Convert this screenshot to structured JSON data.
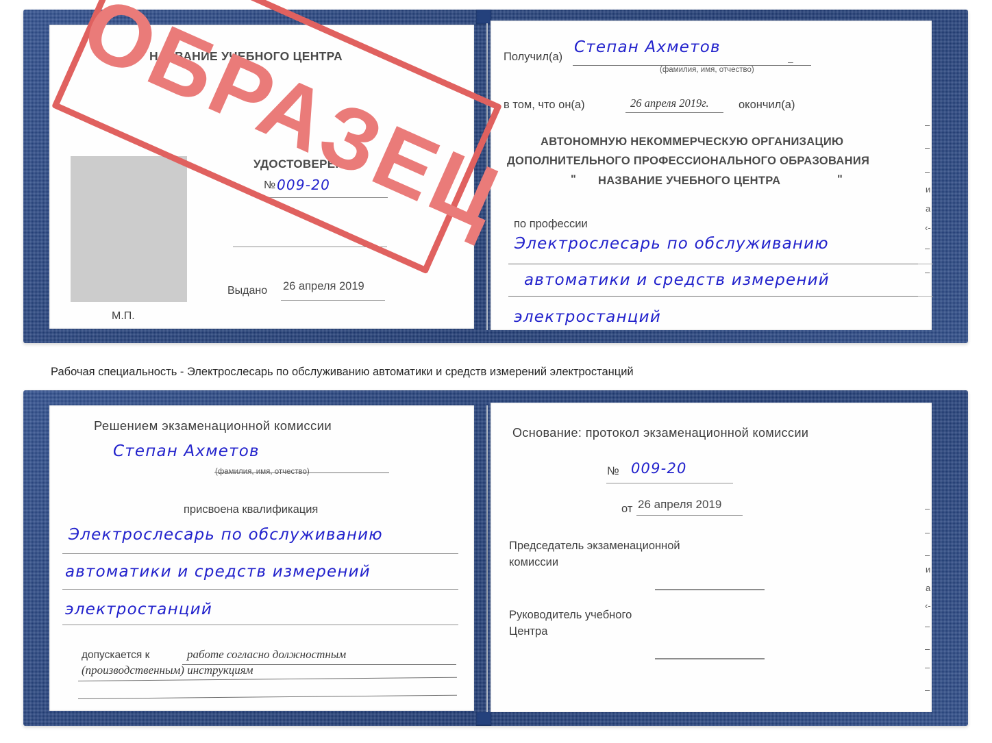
{
  "caption": "Рабочая специальность - Электрослесарь по обслуживанию автоматики и средств измерений электростанций",
  "stamp": {
    "text": "ОБРАЗЕЦ",
    "border_color": "#e0615f",
    "text_color": "#ea7b79"
  },
  "colors": {
    "cover_blue": "#24417c",
    "ink_blue": "#2222cc",
    "paper": "#fefefe",
    "photo_placeholder": "#cccccc",
    "rule_grey": "#8d8d8d"
  },
  "certificate_top": {
    "left_page": {
      "center_name": "НАЗВАНИЕ УЧЕБНОГО ЦЕНТРА",
      "doc_type": "УДОСТОВЕРЕНИЕ",
      "number_label": "№",
      "number_value": "009-20",
      "issued_label": "Выдано",
      "issued_date": "26 апреля 2019",
      "seal_label": "М.П."
    },
    "right_page": {
      "received_label": "Получил(а)",
      "received_name": "Степан Ахметов",
      "name_hint": "(фамилия, имя, отчество)",
      "in_that_label": "в том, что он(а)",
      "completion_date": "26 апреля 2019г.",
      "finished_label": "окончил(а)",
      "org_line1": "АВТОНОМНУЮ НЕКОММЕРЧЕСКУЮ ОРГАНИЗАЦИЮ",
      "org_line2": "ДОПОЛНИТЕЛЬНОГО ПРОФЕССИОНАЛЬНОГО ОБРАЗОВАНИЯ",
      "org_quote_open": "\"",
      "org_line3": "НАЗВАНИЕ УЧЕБНОГО ЦЕНТРА",
      "org_quote_close": "\"",
      "profession_label": "по профессии",
      "profession_line1": "Электрослесарь по обслуживанию",
      "profession_line2": "автоматики и средств измерений",
      "profession_line3": "электростанций"
    },
    "edge_fragments": [
      "–",
      "–",
      "–",
      "и",
      "а",
      "‹-",
      "–",
      "–",
      "–"
    ]
  },
  "certificate_bottom": {
    "left_page": {
      "decision_label": "Решением экзаменационной комиссии",
      "name": "Степан Ахметов",
      "name_hint": "(фамилия, имя, отчество)",
      "qualification_label": "присвоена квалификация",
      "qualification_line1": "Электрослесарь по обслуживанию",
      "qualification_line2": "автоматики и средств измерений",
      "qualification_line3": "электростанций",
      "allowed_label": "допускается к",
      "allowed_line1": "работе согласно должностным",
      "allowed_line2": "(производственным) инструкциям"
    },
    "right_page": {
      "basis_label": "Основание: протокол экзаменационной комиссии",
      "number_label": "№",
      "number_value": "009-20",
      "date_label": "от",
      "date_value": "26 апреля 2019",
      "chairman_line1": "Председатель экзаменационной",
      "chairman_line2": "комиссии",
      "head_line1": "Руководитель учебного",
      "head_line2": "Центра"
    },
    "edge_fragments": [
      "–",
      "–",
      "–",
      "и",
      "а",
      "‹-",
      "–",
      "–",
      "–",
      "–"
    ]
  }
}
